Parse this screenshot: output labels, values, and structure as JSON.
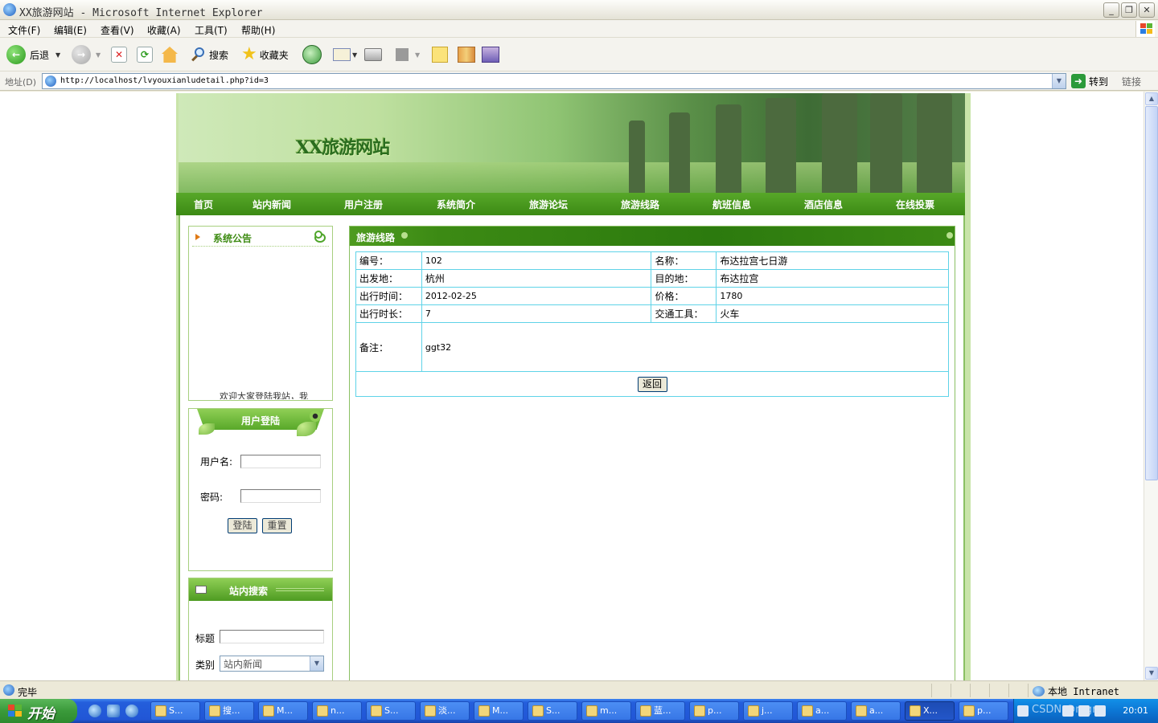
{
  "window": {
    "title": "XX旅游网站 - Microsoft Internet Explorer",
    "buttons": {
      "minimize": "_",
      "restore": "❐",
      "close": "✕"
    }
  },
  "menubar": [
    "文件(F)",
    "编辑(E)",
    "查看(V)",
    "收藏(A)",
    "工具(T)",
    "帮助(H)"
  ],
  "toolbar": {
    "back": "后退",
    "search": "搜索",
    "favorites": "收藏夹"
  },
  "addressbar": {
    "label": "地址(D)",
    "url": "http://localhost/lvyouxianludetail.php?id=3",
    "go": "转到",
    "links": "链接"
  },
  "site": {
    "title": "XX旅游网站",
    "nav": [
      "首页",
      "站内新闻",
      "用户注册",
      "系统简介",
      "旅游论坛",
      "旅游线路",
      "航班信息",
      "酒店信息",
      "在线投票"
    ]
  },
  "notice": {
    "title": "系统公告",
    "marquee": "欢迎大家登陆我站，我"
  },
  "login": {
    "title": "用户登陆",
    "username_label": "用户名:",
    "password_label": "密码:",
    "login_button": "登陆",
    "reset_button": "重置"
  },
  "search": {
    "title": "站内搜索",
    "title_label": "标题",
    "type_label": "类别",
    "type_selected": "站内新闻"
  },
  "detail": {
    "title": "旅游线路",
    "fields": {
      "id_label": "编号：",
      "id": "102",
      "name_label": "名称：",
      "name": "布达拉宫七日游",
      "from_label": "出发地：",
      "from": "杭州",
      "to_label": "目的地：",
      "to": "布达拉宫",
      "date_label": "出行时间：",
      "date": "2012-02-25",
      "price_label": "价格：",
      "price": "1780",
      "duration_label": "出行时长：",
      "duration": "7",
      "transport_label": "交通工具：",
      "transport": "火车",
      "note_label": "备注：",
      "note": "ggt32"
    },
    "back_button": "返回"
  },
  "statusbar": {
    "status": "完毕",
    "zone": "本地 Intranet"
  },
  "taskbar": {
    "start": "开始",
    "tasks": [
      "S...",
      "搜...",
      "M...",
      "n...",
      "S...",
      "淡...",
      "M...",
      "S...",
      "m...",
      "蓝...",
      "p...",
      "j...",
      "a...",
      "a...",
      "X...",
      "p..."
    ],
    "active_task_index": 14,
    "tray_text": "CSDN @mgm",
    "clock": "20:01"
  },
  "colors": {
    "nav_green": "#3c8a14",
    "table_border": "#5fd3e8",
    "title_green": "#2a6d1f"
  }
}
